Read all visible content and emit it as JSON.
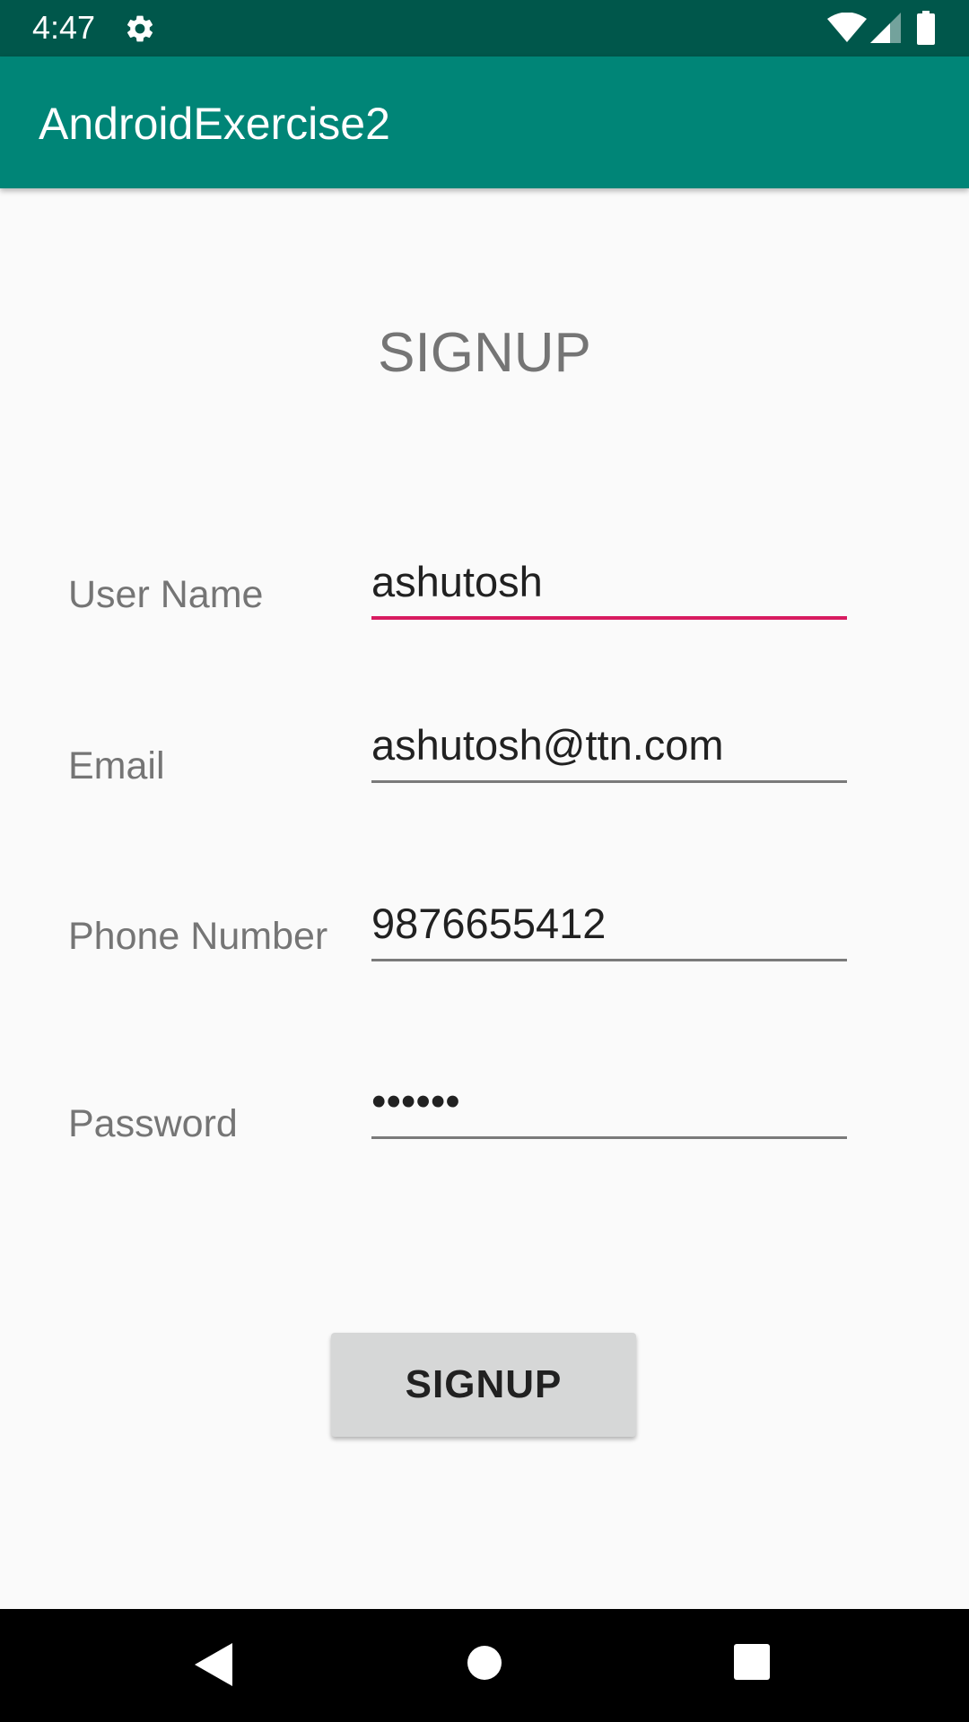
{
  "status_bar": {
    "time": "4:47",
    "icons": [
      "gear-icon",
      "wifi-icon",
      "signal-icon",
      "battery-icon"
    ]
  },
  "app_bar": {
    "title": "AndroidExercise2",
    "color": "#008577"
  },
  "form": {
    "heading": "SIGNUP",
    "fields": [
      {
        "label": "User Name",
        "value": "ashutosh",
        "focused": true
      },
      {
        "label": "Email",
        "value": "ashutosh@ttn.com"
      },
      {
        "label": "Phone Number",
        "value": "9876655412"
      },
      {
        "label": "Password",
        "value": "••••••"
      }
    ],
    "submit_label": "SIGNUP",
    "accent_color": "#d81b60"
  },
  "nav_bar": {
    "icons": [
      "back-icon",
      "home-icon",
      "recents-icon"
    ]
  }
}
